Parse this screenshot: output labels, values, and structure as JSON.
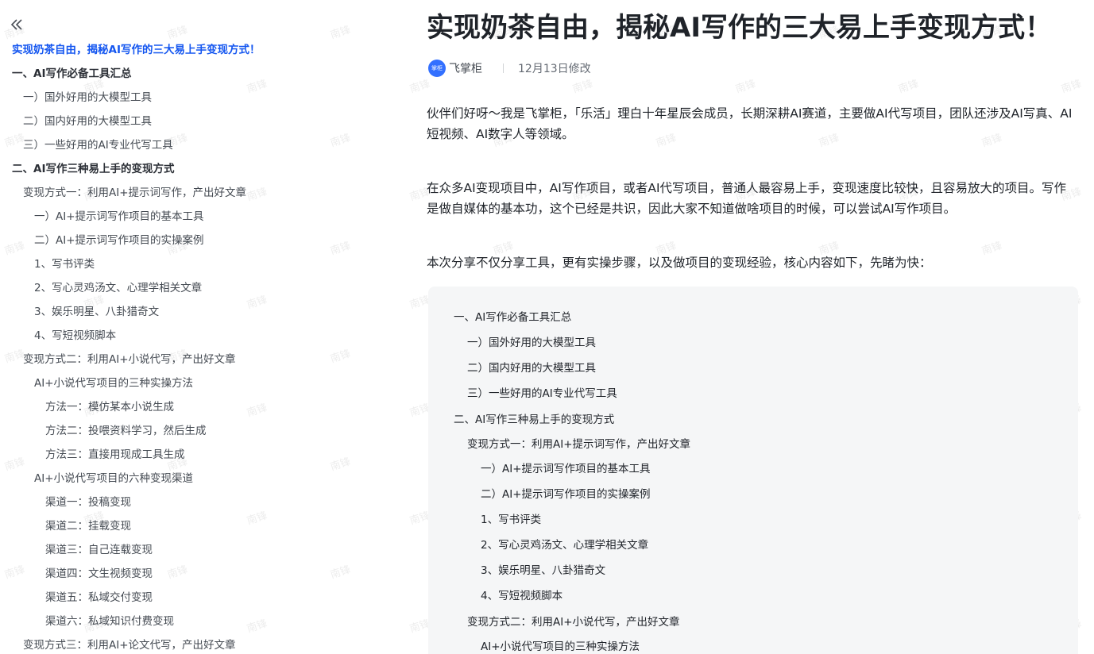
{
  "watermark_text": "南锋",
  "outline": {
    "collapse_icon": "double-chevron-left-icon",
    "title": "实现奶茶自由，揭秘AI写作的三大易上手变现方式！",
    "items": [
      {
        "label": "一、AI写作必备工具汇总"
      },
      {
        "label": "一）国外好用的大模型工具"
      },
      {
        "label": "二）国内好用的大模型工具"
      },
      {
        "label": "三）一些好用的AI专业代写工具"
      },
      {
        "label": "二、AI写作三种易上手的变现方式"
      },
      {
        "label": "变现方式一：利用AI+提示词写作，产出好文章"
      },
      {
        "label": "一）AI+提示词写作项目的基本工具"
      },
      {
        "label": "二）AI+提示词写作项目的实操案例"
      },
      {
        "label": "1、写书评类"
      },
      {
        "label": "2、写心灵鸡汤文、心理学相关文章"
      },
      {
        "label": "3、娱乐明星、八卦猎奇文"
      },
      {
        "label": "4、写短视频脚本"
      },
      {
        "label": "变现方式二：利用AI+小说代写，产出好文章"
      },
      {
        "label": "AI+小说代写项目的三种实操方法"
      },
      {
        "label": "方法一：模仿某本小说生成"
      },
      {
        "label": "方法二：投喂资料学习，然后生成"
      },
      {
        "label": "方法三：直接用现成工具生成"
      },
      {
        "label": "AI+小说代写项目的六种变现渠道"
      },
      {
        "label": "渠道一：投稿变现"
      },
      {
        "label": "渠道二：挂载变现"
      },
      {
        "label": "渠道三：自己连载变现"
      },
      {
        "label": "渠道四：文生视频变现"
      },
      {
        "label": "渠道五：私域交付变现"
      },
      {
        "label": "渠道六：私域知识付费变现"
      },
      {
        "label": "变现方式三：利用AI+论文代写，产出好文章"
      }
    ]
  },
  "article": {
    "title": "实现奶茶自由，揭秘AI写作的三大易上手变现方式！",
    "author_avatar_text": "掌柜",
    "author": "飞掌柜",
    "modified": "12月13日修改",
    "paragraphs": [
      "伙伴们好呀～我是飞掌柜，「乐活」理白十年星辰会成员，长期深耕AI赛道，主要做AI代写项目，团队还涉及AI写真、AI短视频、AI数字人等领域。",
      "在众多AI变现项目中，AI写作项目，或者AI代写项目，普通人最容易上手，变现速度比较快，且容易放大的项目。写作是做自媒体的基本功，这个已经是共识，因此大家不知道做啥项目的时候，可以尝试AI写作项目。",
      "本次分享不仅分享工具，更有实操步骤，以及做项目的变现经验，核心内容如下，先睹为快："
    ],
    "toc": [
      "一、AI写作必备工具汇总",
      "一）国外好用的大模型工具",
      "二）国内好用的大模型工具",
      "三）一些好用的AI专业代写工具",
      "二、AI写作三种易上手的变现方式",
      "变现方式一：利用AI+提示词写作，产出好文章",
      "一）AI+提示词写作项目的基本工具",
      "二）AI+提示词写作项目的实操案例",
      "1、写书评类",
      "2、写心灵鸡汤文、心理学相关文章",
      "3、娱乐明星、八卦猎奇文",
      "4、写短视频脚本",
      "变现方式二：利用AI+小说代写，产出好文章",
      "AI+小说代写项目的三种实操方法"
    ]
  }
}
